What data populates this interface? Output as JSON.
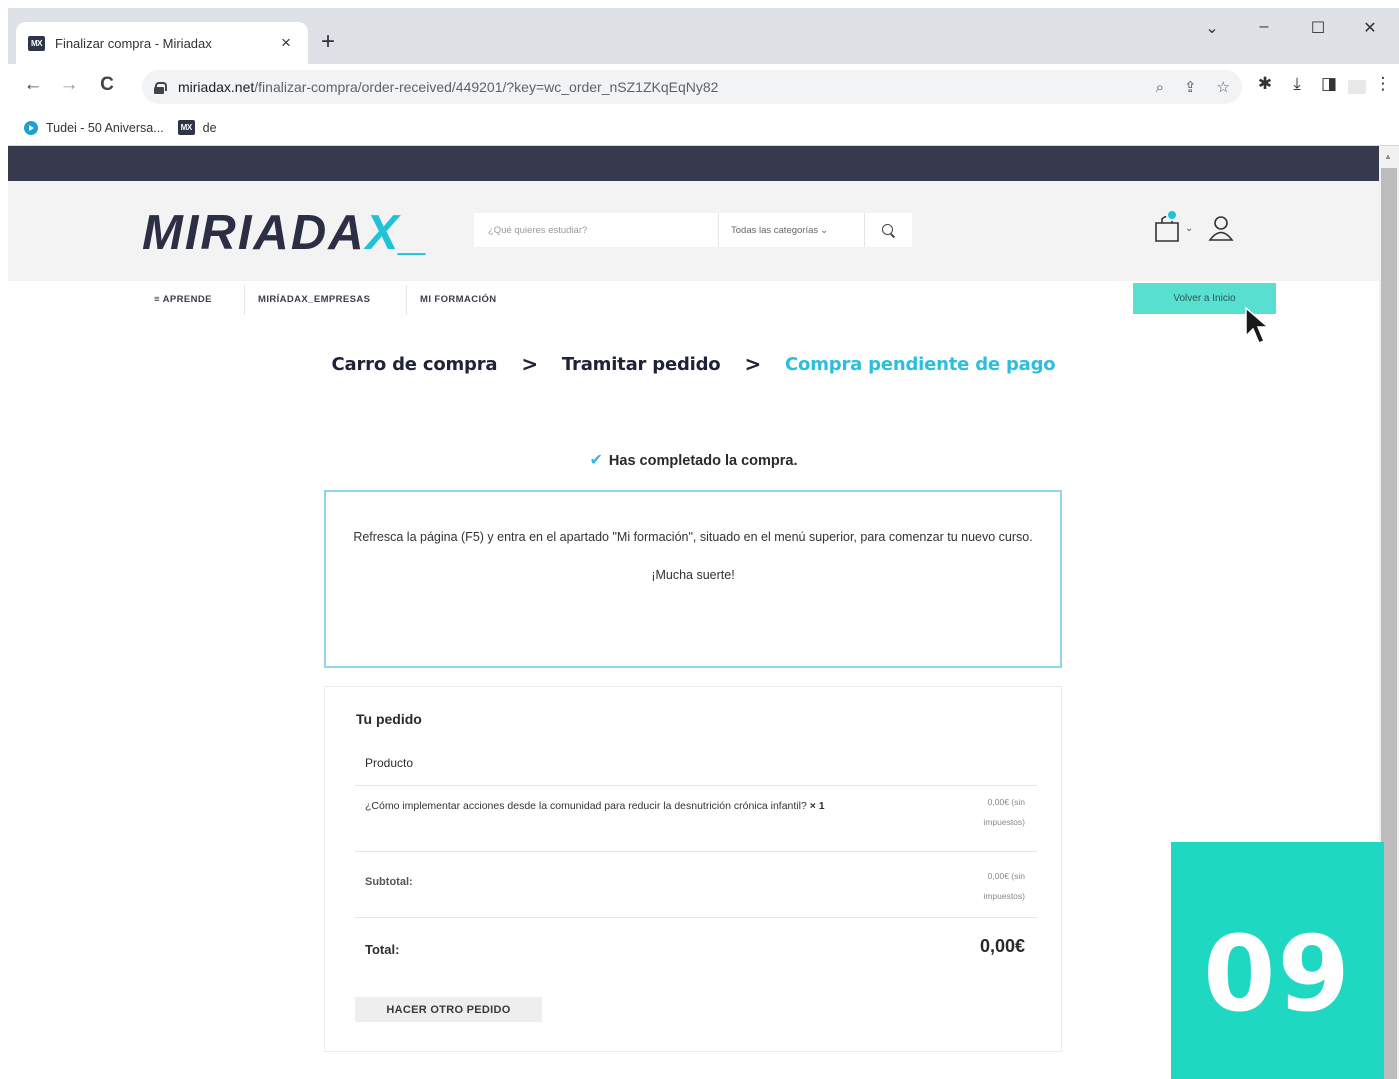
{
  "browser": {
    "tab_title": "Finalizar compra - Miriadax",
    "tab_close": "×",
    "new_tab": "+",
    "favicon_text": "MX",
    "window_controls": {
      "tabsearch": "⌄",
      "minimize": "–",
      "maximize": "☐",
      "close": "✕"
    },
    "nav": {
      "back": "←",
      "forward": "→",
      "reload": "C"
    },
    "url_host": "miriadax.net",
    "url_path": "/finalizar-compra/order-received/449201/?key=wc_order_nSZ1ZKqEqNy82",
    "omnibox_icons": {
      "zoom": "⌕",
      "share": "⇪",
      "bookmark": "☆"
    },
    "extensions": {
      "puzzle": "✱",
      "download": "⤓",
      "sidepanel": "◨",
      "menu": "⋮"
    },
    "bookmarks": [
      {
        "label": "Tudei - 50 Aniversa..."
      },
      {
        "label": "de"
      }
    ]
  },
  "site": {
    "logo_main": "MIRIADA",
    "logo_accent": "X_",
    "search_placeholder": "¿Qué quieres estudiar?",
    "category_select": "Todas las categorías",
    "category_caret": "⌄",
    "cart_caret": "⌄",
    "nav": {
      "aprende": "≡ APRENDE",
      "empresas": "MIRÍADAX_EMPRESAS",
      "formacion": "MI FORMACIÓN"
    },
    "cta_label": "Volver a Inicio"
  },
  "steps": {
    "step1": "Carro de compra",
    "step2": "Tramitar pedido",
    "step3": "Compra pendiente de pago",
    "separator": ">"
  },
  "confirmation": {
    "check": "✔",
    "message": "Has completado la compra."
  },
  "notice": {
    "text": "Refresca la página (F5) y entra en el apartado \"Mi formación\", situado en el menú superior, para comenzar tu nuevo curso.",
    "luck": "¡Mucha suerte!"
  },
  "order": {
    "title": "Tu pedido",
    "header_product": "Producto",
    "item_name": "¿Cómo implementar acciones desde la comunidad para reducir la desnutrición crónica infantil?",
    "item_qty": "× 1",
    "item_price": "0,00€ (sin impuestos)",
    "subtotal_label": "Subtotal:",
    "subtotal_value": "0,00€ (sin impuestos)",
    "total_label": "Total:",
    "total_value": "0,00€",
    "reorder_button": "HACER OTRO PEDIDO"
  },
  "overlay": {
    "step_number": "09"
  },
  "colors": {
    "accent": "#1fc2d6",
    "cta": "#57dfd0",
    "badge": "#1fd8c2",
    "topbar": "#373a4d"
  }
}
